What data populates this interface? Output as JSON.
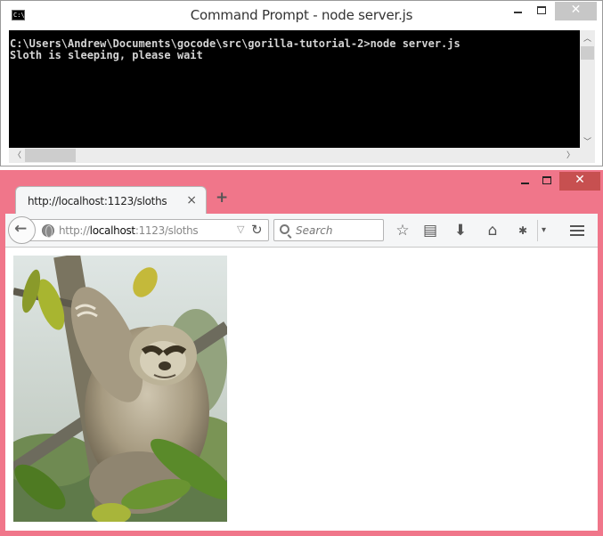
{
  "cmd": {
    "title": "Command Prompt - node  server.js",
    "icon": "cmd-icon",
    "icon_text": "C:\\.",
    "lines": [
      "C:\\Users\\Andrew\\Documents\\gocode\\src\\gorilla-tutorial-2>node server.js",
      "Sloth is sleeping, please wait"
    ]
  },
  "browser": {
    "tab_title": "http://localhost:1123/sloths",
    "tab_close": "×",
    "new_tab": "+",
    "url_prefix": "http://",
    "url_host": "localhost",
    "url_rest": ":1123/sloths",
    "search_placeholder": "Search",
    "frame_color": "#f0768a",
    "icons": [
      "back-arrow-icon",
      "globe-icon",
      "reload-icon",
      "search-icon",
      "star-icon",
      "reading-list-icon",
      "download-icon",
      "home-icon",
      "extension-icon",
      "menu-icon"
    ]
  },
  "content": {
    "image": "three-toed sloth hanging on a tree branch among leaves"
  }
}
